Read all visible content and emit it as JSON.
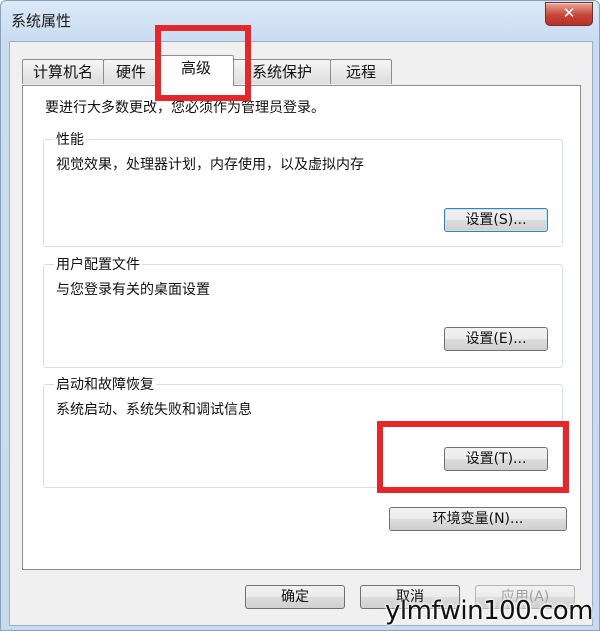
{
  "window": {
    "title": "系统属性",
    "close_symbol": "✕"
  },
  "tabs": [
    {
      "label": "计算机名",
      "active": false
    },
    {
      "label": "硬件",
      "active": false
    },
    {
      "label": "高级",
      "active": true
    },
    {
      "label": "系统保护",
      "active": false
    },
    {
      "label": "远程",
      "active": false
    }
  ],
  "advanced": {
    "admin_notice": "要进行大多数更改，您必须作为管理员登录。",
    "performance": {
      "title": "性能",
      "description": "视觉效果，处理器计划，内存使用，以及虚拟内存",
      "settings_label": "设置(S)..."
    },
    "user_profiles": {
      "title": "用户配置文件",
      "description": "与您登录有关的桌面设置",
      "settings_label": "设置(E)..."
    },
    "startup_recovery": {
      "title": "启动和故障恢复",
      "description": "系统启动、系统失败和调试信息",
      "settings_label": "设置(T)..."
    },
    "env_vars_label": "环境变量(N)..."
  },
  "footer": {
    "ok_label": "确定",
    "cancel_label": "取消",
    "apply_label": "应用(A)"
  },
  "highlight_color": "#e5262b",
  "watermark": "ylmfwin100.com"
}
